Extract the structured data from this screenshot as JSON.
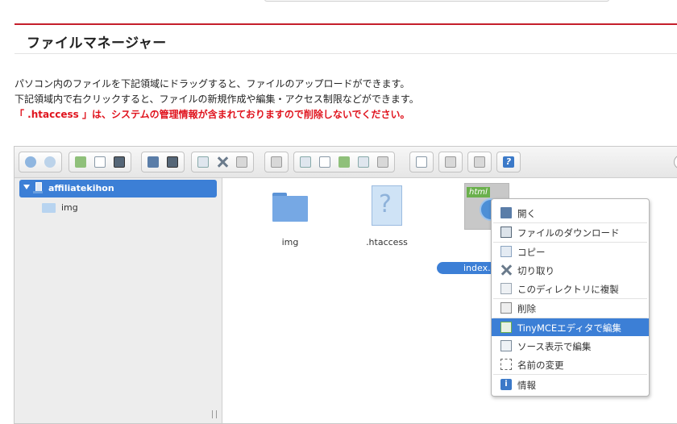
{
  "page": {
    "title": "ファイルマネージャー",
    "description": [
      "パソコン内のファイルを下記領域にドラッグすると、ファイルのアップロードができます。",
      "下記領域内で右クリックすると、ファイルの新規作成や編集・アクセス制限などができます。"
    ],
    "warning": "「 .htaccess 」は、システムの管理情報が含まれておりますので削除しないでください。"
  },
  "toolbar": {
    "icons": [
      "back-icon",
      "forward-icon",
      "upload-icon",
      "new-file-icon",
      "save-icon",
      "open-icon",
      "download-icon",
      "copy-icon",
      "cut-icon",
      "paste-icon",
      "delete-icon",
      "duplicate-icon",
      "rename-icon",
      "edit-icon",
      "edit-source-icon",
      "resize-icon",
      "view-icon",
      "archive-icon",
      "lock-icon",
      "help-icon"
    ]
  },
  "tree": {
    "root": "affiliatekihon",
    "children": [
      "img"
    ]
  },
  "files": [
    {
      "name": "img",
      "type": "folder"
    },
    {
      "name": ".htaccess",
      "type": "unknown"
    },
    {
      "name": "index.",
      "type": "html",
      "selected": true
    }
  ],
  "html_badge": "html",
  "context_menu": {
    "items": [
      {
        "label": "開く",
        "icon": "open-icon"
      },
      {
        "label": "ファイルのダウンロード",
        "icon": "download-icon"
      },
      {
        "label": "コピー",
        "icon": "copy-icon"
      },
      {
        "label": "切り取り",
        "icon": "cut-icon"
      },
      {
        "label": "このディレクトリに複製",
        "icon": "duplicate-icon"
      },
      {
        "label": "削除",
        "icon": "delete-icon"
      },
      {
        "label": "TinyMCEエディタで編集",
        "icon": "tinymce-edit-icon",
        "active": true
      },
      {
        "label": "ソース表示で編集",
        "icon": "source-edit-icon"
      },
      {
        "label": "名前の変更",
        "icon": "rename-icon"
      },
      {
        "label": "情報",
        "icon": "info-icon"
      }
    ]
  },
  "colors": {
    "accent_red": "#c51f2c",
    "warning_red": "#e0141e",
    "selection_blue": "#3c7fd6"
  }
}
